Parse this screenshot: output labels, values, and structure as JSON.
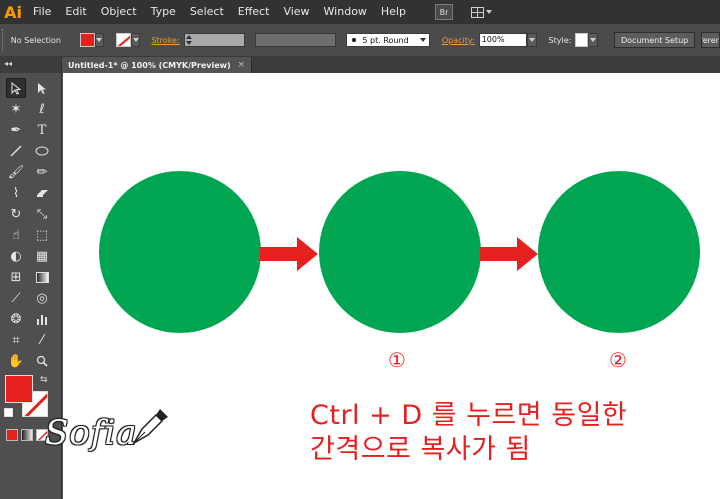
{
  "app": {
    "logo": "Ai"
  },
  "menu": {
    "items": [
      "File",
      "Edit",
      "Object",
      "Type",
      "Select",
      "Effect",
      "View",
      "Window",
      "Help"
    ],
    "bridge_label": "Br"
  },
  "control_bar": {
    "selection": "No Selection",
    "stroke_label": "Stroke:",
    "brush": "5 pt. Round",
    "opacity_label": "Opacity:",
    "opacity_value": "100%",
    "style_label": "Style:",
    "document_setup": "Document Setup",
    "preferences": "Preferences"
  },
  "document_tab": {
    "title": "Untitled-1* @ 100% (CMYK/Preview)",
    "close": "×"
  },
  "tools_panel": {
    "collapse_glyph": "◂◂"
  },
  "canvas": {
    "colors": {
      "circle": "#00a551",
      "arrow": "#e6201f",
      "text": "#e6201f",
      "fill": "#e6201f"
    },
    "markers": [
      "①",
      "②"
    ],
    "caption_lines": [
      "Ctrl + D 를 누르면 동일한",
      "간격으로 복사가 됨"
    ]
  },
  "watermark": {
    "text": "Sofia"
  }
}
